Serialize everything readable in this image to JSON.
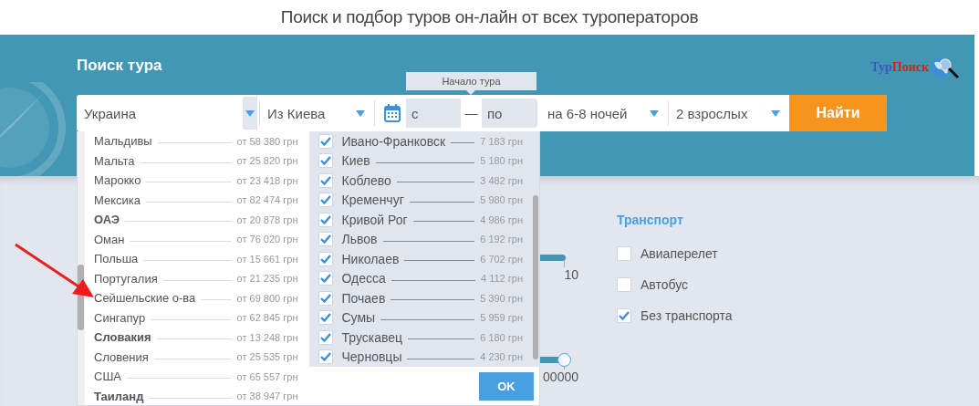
{
  "page_title": "Поиск и подбор туров он-лайн от всех туроператоров",
  "search": {
    "title": "Поиск тура",
    "logo": {
      "part_1": "Тур",
      "part_2": "Поиск"
    },
    "country": "Украина",
    "departure": "Из Киева",
    "date_tooltip": "Начало тура",
    "date_from": {
      "placeholder": "с"
    },
    "date_separator": "—",
    "date_to": {
      "placeholder": "по"
    },
    "nights": "на 6-8 ночей",
    "tourists": "2 взрослых",
    "submit": "Найти"
  },
  "countries": [
    {
      "name": "Мальдивы",
      "price": "от 58 380 грн",
      "bold": false
    },
    {
      "name": "Мальта",
      "price": "от 25 820 грн",
      "bold": false
    },
    {
      "name": "Марокко",
      "price": "от 23 418 грн",
      "bold": false
    },
    {
      "name": "Мексика",
      "price": "от 82 474 грн",
      "bold": false
    },
    {
      "name": "ОАЭ",
      "price": "от 20 878 грн",
      "bold": true
    },
    {
      "name": "Оман",
      "price": "от 76 020 грн",
      "bold": false
    },
    {
      "name": "Польша",
      "price": "от 15 661 грн",
      "bold": false
    },
    {
      "name": "Португалия",
      "price": "от 21 235 грн",
      "bold": false
    },
    {
      "name": "Сейшельские о-ва",
      "price": "от 69 800 грн",
      "bold": false
    },
    {
      "name": "Сингапур",
      "price": "от 62 845 грн",
      "bold": false
    },
    {
      "name": "Словакия",
      "price": "от 13 248 грн",
      "bold": true
    },
    {
      "name": "Словения",
      "price": "от 25 535 грн",
      "bold": false
    },
    {
      "name": "США",
      "price": "от 65 557 грн",
      "bold": false
    },
    {
      "name": "Таиланд",
      "price": "от 38 947 грн",
      "bold": true
    }
  ],
  "cities": [
    {
      "name": "Ивано-Франковск",
      "price": "7 183 грн",
      "checked": true
    },
    {
      "name": "Киев",
      "price": "5 180 грн",
      "checked": true
    },
    {
      "name": "Коблево",
      "price": "3 482 грн",
      "checked": true
    },
    {
      "name": "Кременчуг",
      "price": "5 980 грн",
      "checked": true
    },
    {
      "name": "Кривой Рог",
      "price": "4 986 грн",
      "checked": true
    },
    {
      "name": "Львов",
      "price": "6 192 грн",
      "checked": true
    },
    {
      "name": "Николаев",
      "price": "6 702 грн",
      "checked": true
    },
    {
      "name": "Одесса",
      "price": "4 112 грн",
      "checked": true
    },
    {
      "name": "Почаев",
      "price": "5 390 грн",
      "checked": true
    },
    {
      "name": "Сумы",
      "price": "5 959 грн",
      "checked": true
    },
    {
      "name": "Трускавец",
      "price": "6 180 грн",
      "checked": true
    },
    {
      "name": "Черновцы",
      "price": "4 230 грн",
      "checked": true
    }
  ],
  "ok_button": "OK",
  "range_labels": [
    "10",
    "00000"
  ],
  "transport": {
    "title": "Транспорт",
    "options": [
      {
        "label": "Авиаперелет",
        "checked": false
      },
      {
        "label": "Автобус",
        "checked": false
      },
      {
        "label": "Без транспорта",
        "checked": true
      }
    ]
  }
}
